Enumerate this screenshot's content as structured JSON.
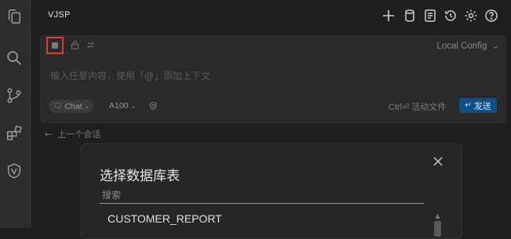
{
  "header": {
    "title": "VJSP"
  },
  "toolbar": {
    "config_select": "Local Config"
  },
  "chat": {
    "placeholder": "输入任意内容，使用「@」添加上下文",
    "mode_label": "Chat",
    "model_label": "A100",
    "at_label": "@",
    "active_file_label": "Ctrl⏎ 活动文件",
    "send_label": "发送"
  },
  "history": {
    "prev_session_label": "上一个会话"
  },
  "dialog": {
    "title": "选择数据库表",
    "search_placeholder": "搜索",
    "items": [
      "CUSTOMER_REPORT"
    ]
  },
  "colors": {
    "accent": "#0e4f8a",
    "highlight_border": "#e03a3a"
  }
}
